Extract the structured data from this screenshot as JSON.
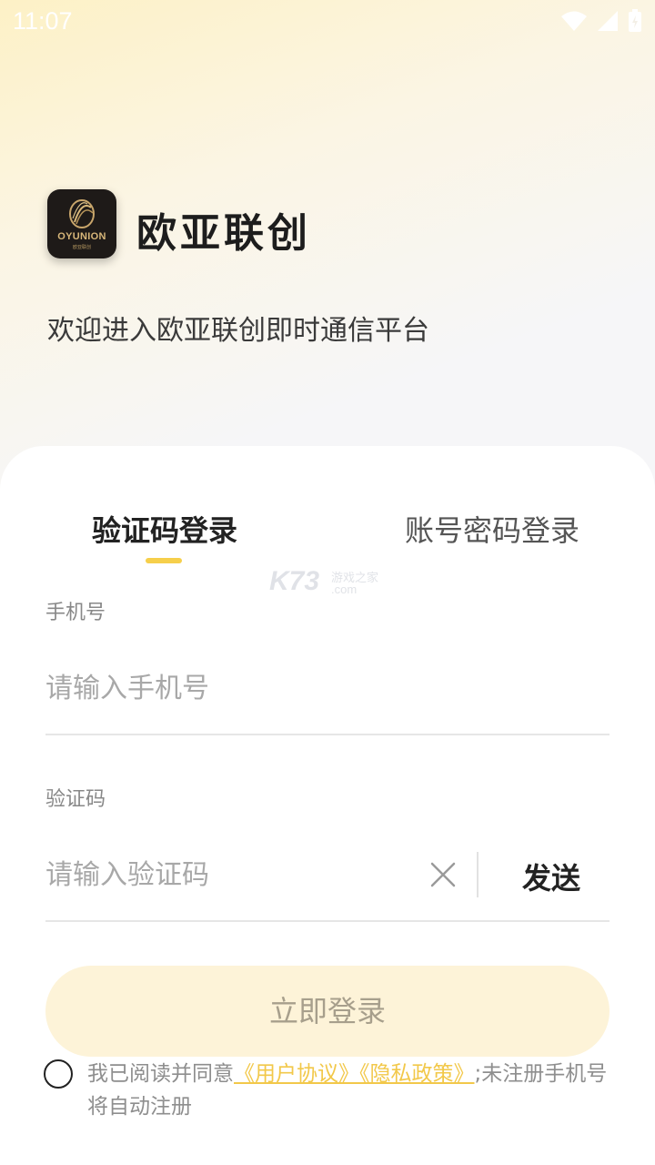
{
  "status_bar": {
    "time": "11:07",
    "icons": [
      "wifi-icon",
      "signal-icon",
      "battery-icon"
    ]
  },
  "brand": {
    "logo_text": "OYUNION",
    "logo_subtext": "欧亚联创",
    "app_name": "欧亚联创",
    "welcome": "欢迎进入欧亚联创即时通信平台"
  },
  "tabs": [
    {
      "label": "验证码登录",
      "active": true
    },
    {
      "label": "账号密码登录",
      "active": false
    }
  ],
  "watermark": {
    "big": "K73",
    "small": "游戏之家",
    "domain": ".com"
  },
  "form": {
    "phone_label": "手机号",
    "phone_placeholder": "请输入手机号",
    "phone_value": "",
    "code_label": "验证码",
    "code_placeholder": "请输入验证码",
    "code_value": "",
    "send_label": "发送",
    "login_label": "立即登录"
  },
  "agreement": {
    "checked": false,
    "prefix": "我已阅读并同意",
    "user_agreement": "《用户协议》",
    "privacy_policy": "《隐私政策》",
    "suffix": ";未注册手机号将自动注册"
  },
  "colors": {
    "accent": "#f6cf4b",
    "button_bg": "#fdf3d8",
    "link": "#f2c84a"
  }
}
